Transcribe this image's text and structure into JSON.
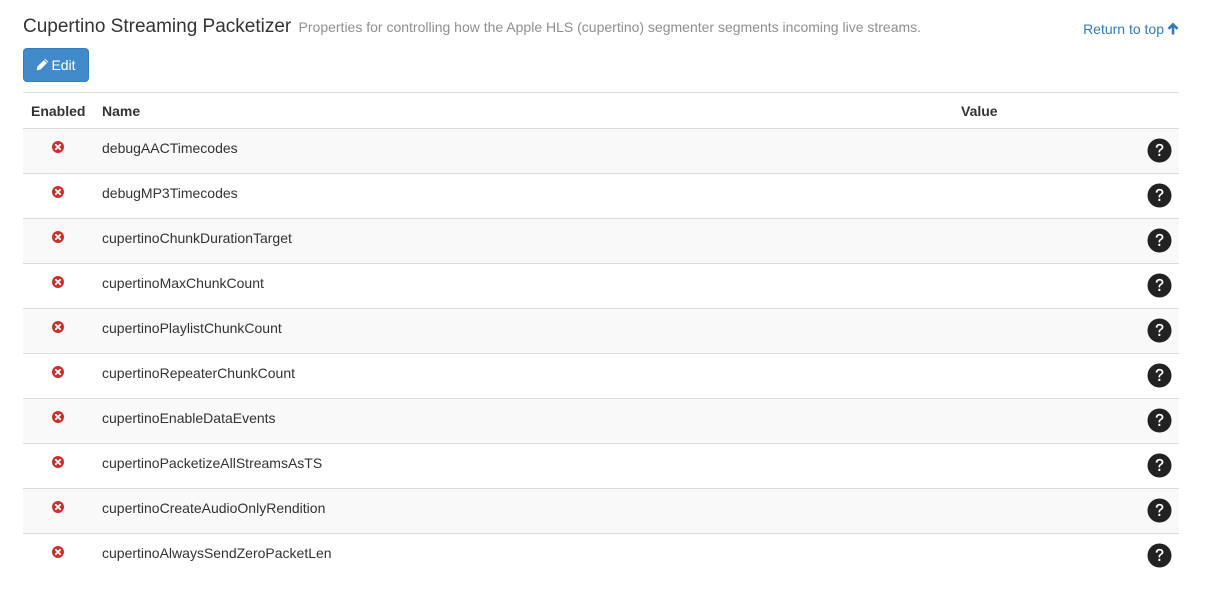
{
  "section": {
    "title": "Cupertino Streaming Packetizer",
    "subtitle": "Properties for controlling how the Apple HLS (cupertino) segmenter segments incoming live streams.",
    "return_link": "Return to top",
    "return_icon": "arrow-up-icon"
  },
  "toolbar": {
    "edit_label": "Edit",
    "edit_icon": "pencil-icon"
  },
  "table": {
    "headers": {
      "enabled": "Enabled",
      "name": "Name",
      "value": "Value"
    },
    "rows": [
      {
        "enabled": false,
        "name": "debugAACTimecodes",
        "value": ""
      },
      {
        "enabled": false,
        "name": "debugMP3Timecodes",
        "value": ""
      },
      {
        "enabled": false,
        "name": "cupertinoChunkDurationTarget",
        "value": ""
      },
      {
        "enabled": false,
        "name": "cupertinoMaxChunkCount",
        "value": ""
      },
      {
        "enabled": false,
        "name": "cupertinoPlaylistChunkCount",
        "value": ""
      },
      {
        "enabled": false,
        "name": "cupertinoRepeaterChunkCount",
        "value": ""
      },
      {
        "enabled": false,
        "name": "cupertinoEnableDataEvents",
        "value": ""
      },
      {
        "enabled": false,
        "name": "cupertinoPacketizeAllStreamsAsTS",
        "value": ""
      },
      {
        "enabled": false,
        "name": "cupertinoCreateAudioOnlyRendition",
        "value": ""
      },
      {
        "enabled": false,
        "name": "cupertinoAlwaysSendZeroPacketLen",
        "value": ""
      }
    ]
  },
  "colors": {
    "accent": "#428bca",
    "link": "#337ab7",
    "disabled_icon": "#c9302c",
    "help_icon": "#222222"
  }
}
